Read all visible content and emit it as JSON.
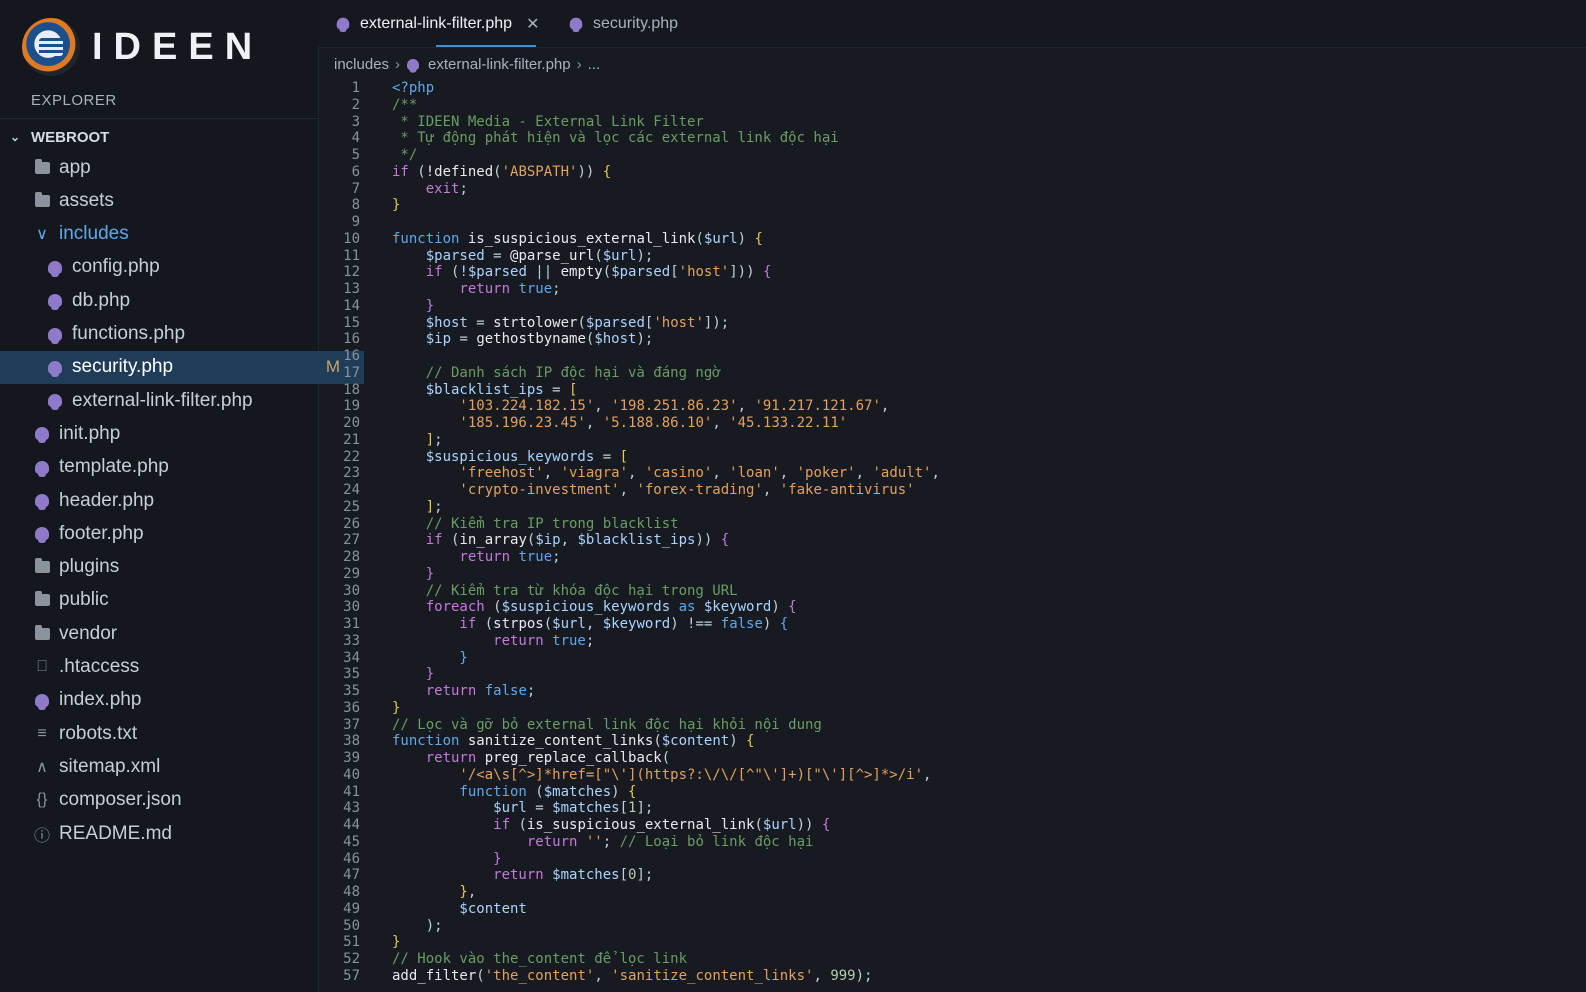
{
  "app": {
    "logo_text": "IDEEN",
    "explorer_title": "EXPLORER"
  },
  "sidebar": {
    "root": "WEBROOT",
    "items": [
      {
        "label": "app",
        "icon": "folder-icon",
        "indent": 1
      },
      {
        "label": "assets",
        "icon": "folder-icon",
        "indent": 1
      },
      {
        "label": "includes",
        "icon": "chevron-down-icon",
        "indent": 1,
        "open": true
      },
      {
        "label": "config.php",
        "icon": "php-icon",
        "indent": 2
      },
      {
        "label": "db.php",
        "icon": "php-icon",
        "indent": 2
      },
      {
        "label": "functions.php",
        "icon": "php-icon",
        "indent": 2
      },
      {
        "label": "security.php",
        "icon": "php-icon",
        "indent": 2,
        "selected": true,
        "badge": "M"
      },
      {
        "label": "external-link-filter.php",
        "icon": "php-icon",
        "indent": 2
      },
      {
        "label": "init.php",
        "icon": "php-icon",
        "indent": 1
      },
      {
        "label": "template.php",
        "icon": "php-icon",
        "indent": 1
      },
      {
        "label": "header.php",
        "icon": "php-icon",
        "indent": 1
      },
      {
        "label": "footer.php",
        "icon": "php-icon",
        "indent": 1
      },
      {
        "label": "plugins",
        "icon": "folder-icon",
        "indent": 1
      },
      {
        "label": "public",
        "icon": "folder-icon",
        "indent": 1
      },
      {
        "label": "vendor",
        "icon": "folder-icon",
        "indent": 1
      },
      {
        "label": ".htaccess",
        "icon": "file-icon",
        "indent": 1
      },
      {
        "label": "index.php",
        "icon": "php-icon",
        "indent": 1
      },
      {
        "label": "robots.txt",
        "icon": "lines-icon",
        "indent": 1
      },
      {
        "label": "sitemap.xml",
        "icon": "xml-icon",
        "indent": 1
      },
      {
        "label": "composer.json",
        "icon": "braces-icon",
        "indent": 1
      },
      {
        "label": "README.md",
        "icon": "info-icon",
        "indent": 1
      }
    ]
  },
  "tabs": [
    {
      "label": "external-link-filter.php",
      "active": true
    },
    {
      "label": "security.php",
      "active": false
    }
  ],
  "tab_close": "✕",
  "breadcrumb": {
    "folder": "includes",
    "file": "external-link-filter.php",
    "more": "..."
  },
  "editor": {
    "lines": [
      {
        "n": "1",
        "t": [
          [
            "tag",
            "<?php"
          ]
        ]
      },
      {
        "n": "2",
        "t": [
          [
            "cmt",
            "/**"
          ]
        ]
      },
      {
        "n": "3",
        "t": [
          [
            "cmt",
            " * IDEEN Media - External Link Filter"
          ]
        ]
      },
      {
        "n": "4",
        "t": [
          [
            "cmt",
            " * Tự động phát hiện và lọc các external link độc hại"
          ]
        ]
      },
      {
        "n": "5",
        "t": [
          [
            "cmt",
            " */"
          ]
        ]
      },
      {
        "n": "6",
        "t": [
          [
            "ctl",
            "if"
          ],
          [
            "pun",
            " ("
          ],
          [
            "fn",
            "!defined"
          ],
          [
            "pun",
            "("
          ],
          [
            "str",
            "'ABSPATH'"
          ],
          [
            "pun",
            "))"
          ],
          [
            "br",
            " {"
          ]
        ]
      },
      {
        "n": "7",
        "t": [
          [
            "ctl",
            "    exit"
          ],
          [
            "pun",
            ";"
          ]
        ]
      },
      {
        "n": "8",
        "t": [
          [
            "br",
            "}"
          ]
        ]
      },
      {
        "n": "9",
        "t": []
      },
      {
        "n": "10",
        "t": [
          [
            "kw",
            "function"
          ],
          [
            "fn",
            " is_suspicious_external_link"
          ],
          [
            "pun",
            "("
          ],
          [
            "var",
            "$url"
          ],
          [
            "pun",
            ")"
          ],
          [
            "br",
            " {"
          ]
        ]
      },
      {
        "n": "11",
        "t": [
          [
            "var",
            "    $parsed"
          ],
          [
            "pun",
            " = "
          ],
          [
            "fn",
            "@parse_url"
          ],
          [
            "pun",
            "("
          ],
          [
            "var",
            "$url"
          ],
          [
            "pun",
            ");"
          ]
        ]
      },
      {
        "n": "12",
        "t": [
          [
            "ctl",
            "    if"
          ],
          [
            "pun",
            " ("
          ],
          [
            "var",
            "!$parsed"
          ],
          [
            "pun",
            " || "
          ],
          [
            "fn",
            "empty"
          ],
          [
            "pun",
            "("
          ],
          [
            "var",
            "$parsed"
          ],
          [
            "pun",
            "["
          ],
          [
            "str",
            "'host'"
          ],
          [
            "pun",
            "])) "
          ],
          [
            "ctl",
            "{"
          ]
        ]
      },
      {
        "n": "13",
        "t": [
          [
            "ctl",
            "        return"
          ],
          [
            "kw",
            " true"
          ],
          [
            "pun",
            ";"
          ]
        ]
      },
      {
        "n": "14",
        "t": [
          [
            "ctl",
            "    }"
          ]
        ]
      },
      {
        "n": "15",
        "t": [
          [
            "var",
            "    $host"
          ],
          [
            "pun",
            " = "
          ],
          [
            "fn",
            "strtolower"
          ],
          [
            "pun",
            "("
          ],
          [
            "var",
            "$parsed"
          ],
          [
            "pun",
            "["
          ],
          [
            "str",
            "'host'"
          ],
          [
            "pun",
            "]);"
          ]
        ]
      },
      {
        "n": "16",
        "t": [
          [
            "var",
            "    $ip"
          ],
          [
            "pun",
            " = "
          ],
          [
            "fn",
            "gethostbyname"
          ],
          [
            "pun",
            "("
          ],
          [
            "var",
            "$host"
          ],
          [
            "pun",
            ");"
          ]
        ]
      },
      {
        "n": "16",
        "t": []
      },
      {
        "n": "17",
        "t": [
          [
            "cmt",
            "    // Danh sách IP độc hại và đáng ngờ"
          ]
        ]
      },
      {
        "n": "18",
        "t": [
          [
            "var",
            "    $blacklist_ips"
          ],
          [
            "pun",
            " = "
          ],
          [
            "br",
            "["
          ]
        ]
      },
      {
        "n": "19",
        "t": [
          [
            "str",
            "        '103.224.182.15'"
          ],
          [
            "pun",
            ", "
          ],
          [
            "str",
            "'198.251.86.23'"
          ],
          [
            "pun",
            ", "
          ],
          [
            "str",
            "'91.217.121.67'"
          ],
          [
            "pun",
            ","
          ]
        ]
      },
      {
        "n": "20",
        "t": [
          [
            "str",
            "        '185.196.23.45'"
          ],
          [
            "pun",
            ", "
          ],
          [
            "str",
            "'5.188.86.10'"
          ],
          [
            "pun",
            ", "
          ],
          [
            "str",
            "'45.133.22.11'"
          ]
        ]
      },
      {
        "n": "21",
        "t": [
          [
            "br",
            "    ]"
          ],
          [
            "pun",
            ";"
          ]
        ]
      },
      {
        "n": "22",
        "t": [
          [
            "var",
            "    $suspicious_keywords"
          ],
          [
            "pun",
            " = "
          ],
          [
            "br",
            "["
          ]
        ]
      },
      {
        "n": "23",
        "t": [
          [
            "str",
            "        'freehost'"
          ],
          [
            "pun",
            ", "
          ],
          [
            "str",
            "'viagra'"
          ],
          [
            "pun",
            ", "
          ],
          [
            "str",
            "'casino'"
          ],
          [
            "pun",
            ", "
          ],
          [
            "str",
            "'loan'"
          ],
          [
            "pun",
            ", "
          ],
          [
            "str",
            "'poker'"
          ],
          [
            "pun",
            ", "
          ],
          [
            "str",
            "'adult'"
          ],
          [
            "pun",
            ","
          ]
        ]
      },
      {
        "n": "24",
        "t": [
          [
            "str",
            "        'crypto-investment'"
          ],
          [
            "pun",
            ", "
          ],
          [
            "str",
            "'forex-trading'"
          ],
          [
            "pun",
            ", "
          ],
          [
            "str",
            "'fake-antivirus'"
          ]
        ]
      },
      {
        "n": "25",
        "t": [
          [
            "br",
            "    ]"
          ],
          [
            "pun",
            ";"
          ]
        ]
      },
      {
        "n": "26",
        "t": [
          [
            "cmt",
            "    // Kiểm tra IP trong blacklist"
          ]
        ]
      },
      {
        "n": "27",
        "t": [
          [
            "ctl",
            "    if"
          ],
          [
            "pun",
            " ("
          ],
          [
            "fn",
            "in_array"
          ],
          [
            "pun",
            "("
          ],
          [
            "var",
            "$ip"
          ],
          [
            "pun",
            ", "
          ],
          [
            "var",
            "$blacklist_ips"
          ],
          [
            "pun",
            "))"
          ],
          [
            "ctl",
            " {"
          ]
        ]
      },
      {
        "n": "28",
        "t": [
          [
            "ctl",
            "        return"
          ],
          [
            "kw",
            " true"
          ],
          [
            "pun",
            ";"
          ]
        ]
      },
      {
        "n": "29",
        "t": [
          [
            "ctl",
            "    }"
          ]
        ]
      },
      {
        "n": "30",
        "t": [
          [
            "cmt",
            "    // Kiểm tra từ khóa độc hại trong URL"
          ]
        ]
      },
      {
        "n": "30",
        "t": [
          [
            "ctl",
            "    foreach"
          ],
          [
            "pun",
            " ("
          ],
          [
            "var",
            "$suspicious_keywords"
          ],
          [
            "kw",
            " as"
          ],
          [
            "var",
            " $keyword"
          ],
          [
            "pun",
            ")"
          ],
          [
            "ctl",
            " {"
          ]
        ]
      },
      {
        "n": "31",
        "t": [
          [
            "ctl",
            "        if"
          ],
          [
            "pun",
            " ("
          ],
          [
            "fn",
            "strpos"
          ],
          [
            "pun",
            "("
          ],
          [
            "var",
            "$url"
          ],
          [
            "pun",
            ", "
          ],
          [
            "var",
            "$keyword"
          ],
          [
            "pun",
            ") !== "
          ],
          [
            "kw",
            "false"
          ],
          [
            "pun",
            ")"
          ],
          [
            "kw",
            " {"
          ]
        ]
      },
      {
        "n": "33",
        "t": [
          [
            "ctl",
            "            return"
          ],
          [
            "kw",
            " true"
          ],
          [
            "pun",
            ";"
          ]
        ]
      },
      {
        "n": "34",
        "t": [
          [
            "kw",
            "        }"
          ]
        ]
      },
      {
        "n": "35",
        "t": [
          [
            "ctl",
            "    }"
          ]
        ]
      },
      {
        "n": "35",
        "t": [
          [
            "ctl",
            "    return"
          ],
          [
            "kw",
            " false"
          ],
          [
            "pun",
            ";"
          ]
        ]
      },
      {
        "n": "36",
        "t": [
          [
            "br",
            "}"
          ]
        ]
      },
      {
        "n": "37",
        "t": [
          [
            "cmt",
            "// Lọc và gỡ bỏ external link độc hại khỏi nội dung"
          ]
        ]
      },
      {
        "n": "38",
        "t": [
          [
            "kw",
            "function"
          ],
          [
            "fn",
            " sanitize_content_links"
          ],
          [
            "pun",
            "("
          ],
          [
            "var",
            "$content"
          ],
          [
            "pun",
            ")"
          ],
          [
            "br",
            " {"
          ]
        ]
      },
      {
        "n": "39",
        "t": [
          [
            "ctl",
            "    return"
          ],
          [
            "fn",
            " preg_replace_callback"
          ],
          [
            "pun",
            "("
          ]
        ]
      },
      {
        "n": "40",
        "t": [
          [
            "str",
            "        '/<a\\s[^>]*href=[\"\\'](https?:\\/\\/[^\"\\']+)[\"\\'][^>]*>/i'"
          ],
          [
            "pun",
            ","
          ]
        ]
      },
      {
        "n": "41",
        "t": [
          [
            "kw",
            "        function"
          ],
          [
            "pun",
            " ("
          ],
          [
            "var",
            "$matches"
          ],
          [
            "pun",
            ")"
          ],
          [
            "br",
            " {"
          ]
        ]
      },
      {
        "n": "43",
        "t": [
          [
            "var",
            "            $url"
          ],
          [
            "pun",
            " = "
          ],
          [
            "var",
            "$matches"
          ],
          [
            "pun",
            "["
          ],
          [
            "num",
            "1"
          ],
          [
            "pun",
            "];"
          ]
        ]
      },
      {
        "n": "44",
        "t": [
          [
            "ctl",
            "            if"
          ],
          [
            "pun",
            " ("
          ],
          [
            "fn",
            "is_suspicious_external_link"
          ],
          [
            "pun",
            "("
          ],
          [
            "var",
            "$url"
          ],
          [
            "pun",
            "))"
          ],
          [
            "ctl",
            " {"
          ]
        ]
      },
      {
        "n": "45",
        "t": [
          [
            "ctl",
            "                return"
          ],
          [
            "str",
            " ''"
          ],
          [
            "pun",
            "; "
          ],
          [
            "cmt",
            "// Loại bỏ link độc hại"
          ]
        ]
      },
      {
        "n": "46",
        "t": [
          [
            "ctl",
            "            }"
          ]
        ]
      },
      {
        "n": "47",
        "t": [
          [
            "ctl",
            "            return"
          ],
          [
            "var",
            " $matches"
          ],
          [
            "pun",
            "["
          ],
          [
            "num",
            "0"
          ],
          [
            "pun",
            "];"
          ]
        ]
      },
      {
        "n": "48",
        "t": [
          [
            "br",
            "        }"
          ],
          [
            "pun",
            ","
          ]
        ]
      },
      {
        "n": "49",
        "t": [
          [
            "var",
            "        $content"
          ]
        ]
      },
      {
        "n": "50",
        "t": [
          [
            "pun",
            "    );"
          ]
        ]
      },
      {
        "n": "51",
        "t": [
          [
            "br",
            "}"
          ]
        ]
      },
      {
        "n": "52",
        "t": [
          [
            "cmt",
            "// Hook vào the_content để lọc link"
          ]
        ]
      },
      {
        "n": "57",
        "t": [
          [
            "fn",
            "add_filter"
          ],
          [
            "pun",
            "("
          ],
          [
            "str",
            "'the_content'"
          ],
          [
            "pun",
            ", "
          ],
          [
            "str",
            "'sanitize_content_links'"
          ],
          [
            "pun",
            ", "
          ],
          [
            "num",
            "999"
          ],
          [
            "pun",
            ");"
          ]
        ]
      }
    ]
  }
}
